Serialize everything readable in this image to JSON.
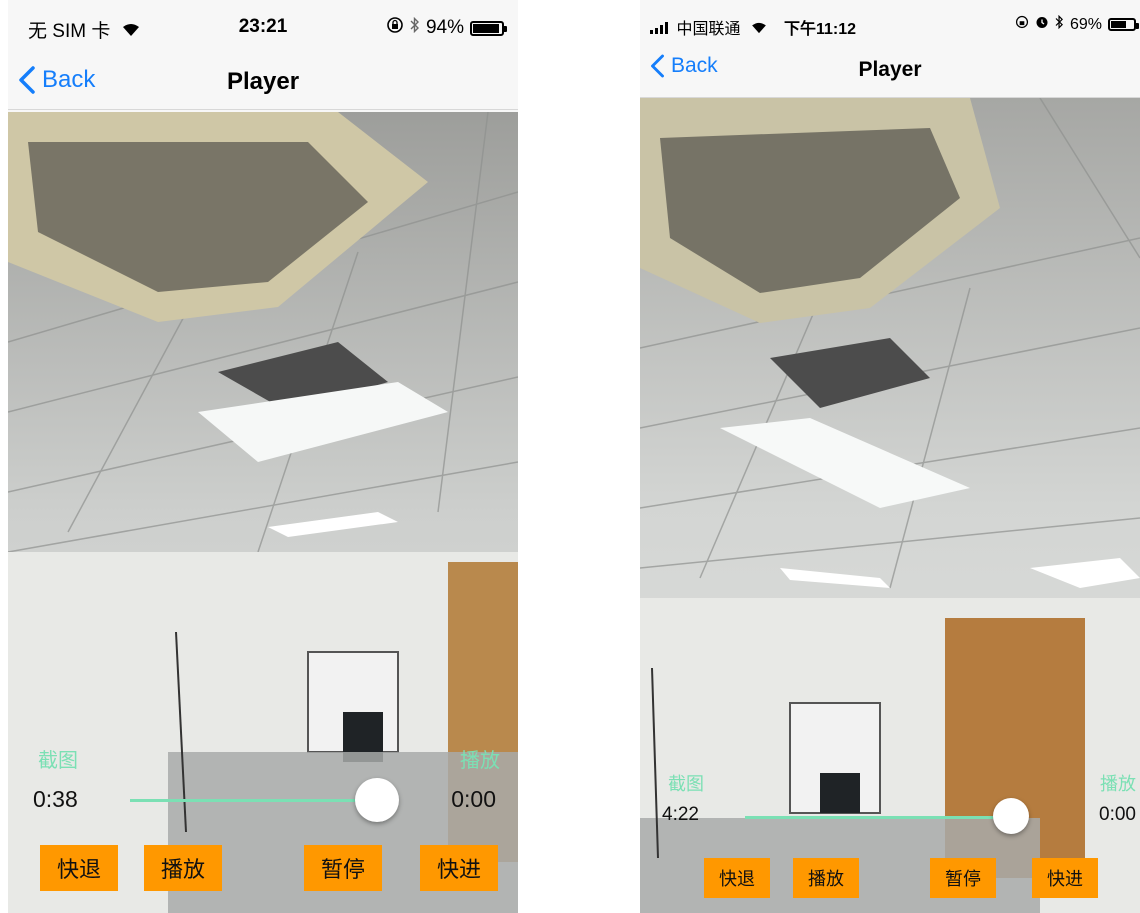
{
  "left": {
    "status": {
      "carrier": "无 SIM 卡",
      "time": "23:21",
      "battery_text": "94%",
      "battery_level": 0.94
    },
    "nav": {
      "back_label": "Back",
      "title": "Player"
    },
    "controls": {
      "capture_label": "截图",
      "play_state_label": "播放",
      "current_time": "0:38",
      "duration": "0:00",
      "progress": 0.92,
      "buttons": {
        "rewind": "快退",
        "play": "播放",
        "pause": "暂停",
        "forward": "快进"
      }
    }
  },
  "right": {
    "status": {
      "carrier": "中国联通",
      "time": "下午11:12",
      "battery_text": "69%",
      "battery_level": 0.69
    },
    "nav": {
      "back_label": "Back",
      "title": "Player"
    },
    "controls": {
      "capture_label": "截图",
      "play_state_label": "播放",
      "current_time": "4:22",
      "duration": "0:00",
      "progress": 0.95,
      "buttons": {
        "rewind": "快退",
        "play": "播放",
        "pause": "暂停",
        "forward": "快进"
      }
    }
  },
  "theme": {
    "accent": "#157efb",
    "button_bg": "#ff9800",
    "slider_color": "#7be0b4"
  }
}
